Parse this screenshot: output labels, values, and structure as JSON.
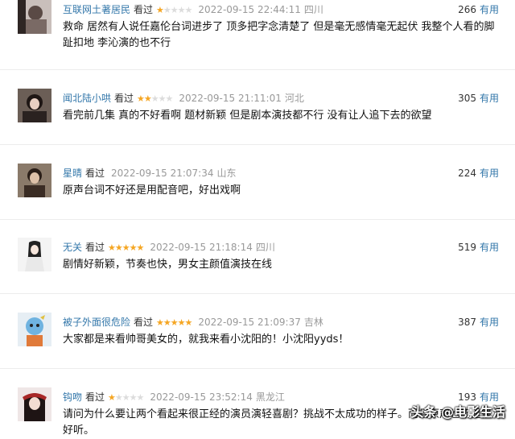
{
  "comments": [
    {
      "user": "互联网土著居民",
      "watched": "看过",
      "rating": 1,
      "time": "2022-09-15 22:44:11",
      "location": "四川",
      "votes": "266",
      "useful": "有用",
      "text": "救命 居然有人说任嘉伦台词进步了 顶多把字念清楚了 但是毫无感情毫无起伏 我整个人看的脚趾扣地 李沁演的也不行",
      "avatar_color": "#6a5a55"
    },
    {
      "user": "闻北陆小哄",
      "watched": "看过",
      "rating": 2,
      "time": "2022-09-15 21:11:01",
      "location": "河北",
      "votes": "305",
      "useful": "有用",
      "text": "看完前几集 真的不好看啊 题材新颖 但是剧本演技都不行 没有让人追下去的欲望",
      "avatar_color": "#3a2e2a"
    },
    {
      "user": "星晴",
      "watched": "看过",
      "rating": 0,
      "time": "2022-09-15 21:07:34",
      "location": "山东",
      "votes": "224",
      "useful": "有用",
      "text": "原声台词不好还是用配音吧，好出戏啊",
      "avatar_color": "#4a3b30"
    },
    {
      "user": "无关",
      "watched": "看过",
      "rating": 5,
      "time": "2022-09-15 21:18:14",
      "location": "四川",
      "votes": "519",
      "useful": "有用",
      "text": "剧情好新颖，节奏也快，男女主颜值演技在线",
      "avatar_color": "#f2f2f2"
    },
    {
      "user": "被子外面很危险",
      "watched": "看过",
      "rating": 5,
      "time": "2022-09-15 21:09:37",
      "location": "吉林",
      "votes": "387",
      "useful": "有用",
      "text": "大家都是来看帅哥美女的，就我来看小沈阳的！小沈阳yyds！",
      "avatar_color": "#dfe9f2"
    },
    {
      "user": "钩吻",
      "watched": "看过",
      "rating": 1,
      "time": "2022-09-15 23:52:14",
      "location": "黑龙江",
      "votes": "193",
      "useful": "有用",
      "text": "请问为什么要让两个看起来很正经的演员演轻喜剧？挑战不太成功的样子。而且原声也不是很好听。",
      "avatar_color": "#7a2a2a"
    }
  ],
  "watermark": "头条 @电影生活"
}
